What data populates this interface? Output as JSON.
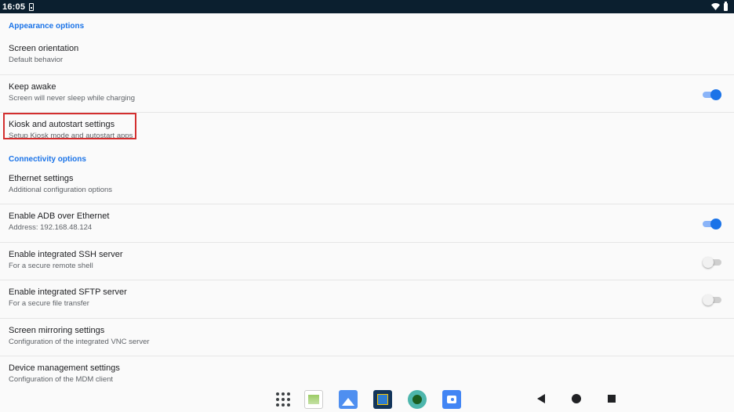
{
  "status_bar": {
    "time": "16:05"
  },
  "sections": [
    {
      "header": "Appearance options",
      "rows": [
        {
          "title": "Screen orientation",
          "subtitle": "Default behavior"
        },
        {
          "title": "Keep awake",
          "subtitle": "Screen will never sleep while charging",
          "toggle": "on"
        },
        {
          "title": "Kiosk and autostart settings",
          "subtitle": "Setup Kiosk mode and autostart apps",
          "highlighted": true
        }
      ]
    },
    {
      "header": "Connectivity options",
      "rows": [
        {
          "title": "Ethernet settings",
          "subtitle": "Additional configuration options"
        },
        {
          "title": "Enable ADB over Ethernet",
          "subtitle": "Address: 192.168.48.124",
          "toggle": "on"
        },
        {
          "title": "Enable integrated SSH server",
          "subtitle": "For a secure remote shell",
          "toggle": "off"
        },
        {
          "title": "Enable integrated SFTP server",
          "subtitle": "For a secure file transfer",
          "toggle": "off"
        },
        {
          "title": "Screen mirroring settings",
          "subtitle": "Configuration of the integrated VNC server"
        },
        {
          "title": "Device management settings",
          "subtitle": "Configuration of the MDM client"
        }
      ]
    }
  ],
  "highlight_color": "#d32f2f",
  "accent_color": "#1a73e8",
  "taskbar": {
    "dock": [
      "apps-grid-icon",
      "app-icon",
      "gallery-app-icon",
      "app-icon",
      "app-icon",
      "camera-app-icon"
    ],
    "nav": [
      "back-icon",
      "home-icon",
      "recents-icon"
    ]
  }
}
